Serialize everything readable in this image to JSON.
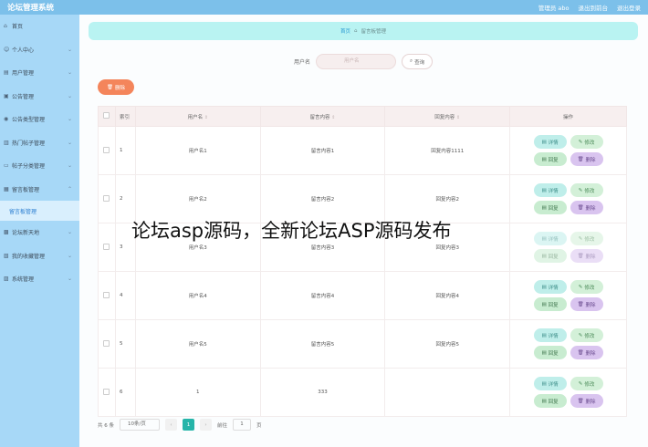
{
  "topbar": {
    "title": "论坛管理系统",
    "user": "管理员 abo",
    "back_to_front": "退出到前台",
    "logout": "退出登录"
  },
  "sidebar": {
    "items": [
      {
        "label": "首页",
        "icon": "home-icon",
        "chevron": false
      },
      {
        "label": "个人中心",
        "icon": "user-icon",
        "chevron": true
      },
      {
        "label": "用户管理",
        "icon": "users-icon",
        "chevron": true
      },
      {
        "label": "公告管理",
        "icon": "notice-icon",
        "chevron": true
      },
      {
        "label": "公告类型管理",
        "icon": "tag-icon",
        "chevron": true
      },
      {
        "label": "热门帖子管理",
        "icon": "fire-icon",
        "chevron": true
      },
      {
        "label": "帖子分类管理",
        "icon": "category-icon",
        "chevron": true
      },
      {
        "label": "留言板管理",
        "icon": "message-icon",
        "chevron": true
      },
      {
        "label": "留言板管理",
        "icon": "",
        "chevron": false,
        "sub": true
      },
      {
        "label": "论坛新天地",
        "icon": "forum-icon",
        "chevron": true
      },
      {
        "label": "我的收藏管理",
        "icon": "star-icon",
        "chevron": true
      },
      {
        "label": "系统管理",
        "icon": "gear-icon",
        "chevron": true
      }
    ]
  },
  "breadcrumb": {
    "home": "首页",
    "current": "留言板管理"
  },
  "search": {
    "label": "用户名",
    "placeholder": "用户名",
    "button": "查询"
  },
  "toolbar": {
    "delete_label": "删除"
  },
  "table": {
    "headers": {
      "index": "索引",
      "username": "用户名",
      "message": "留言内容",
      "reply": "回复内容",
      "ops": "操作"
    },
    "rows": [
      {
        "index": "1",
        "username": "用户名1",
        "message": "留言内容1",
        "reply": "回复内容1111"
      },
      {
        "index": "2",
        "username": "用户名2",
        "message": "留言内容2",
        "reply": "回复内容2"
      },
      {
        "index": "3",
        "username": "用户名3",
        "message": "留言内容3",
        "reply": "回复内容3"
      },
      {
        "index": "4",
        "username": "用户名4",
        "message": "留言内容4",
        "reply": "回复内容4"
      },
      {
        "index": "5",
        "username": "用户名5",
        "message": "留言内容5",
        "reply": "回复内容5"
      },
      {
        "index": "6",
        "username": "1",
        "message": "333",
        "reply": ""
      }
    ],
    "ops": {
      "detail": "详情",
      "edit": "修改",
      "reply": "回复",
      "delete": "删除"
    }
  },
  "pagination": {
    "total": "共 6 条",
    "page_size": "10条/页",
    "current_page": "1",
    "goto_label": "前往",
    "goto_value": "1",
    "page_unit": "页"
  },
  "overlay_text": "论坛asp源码，全新论坛ASP源码发布"
}
